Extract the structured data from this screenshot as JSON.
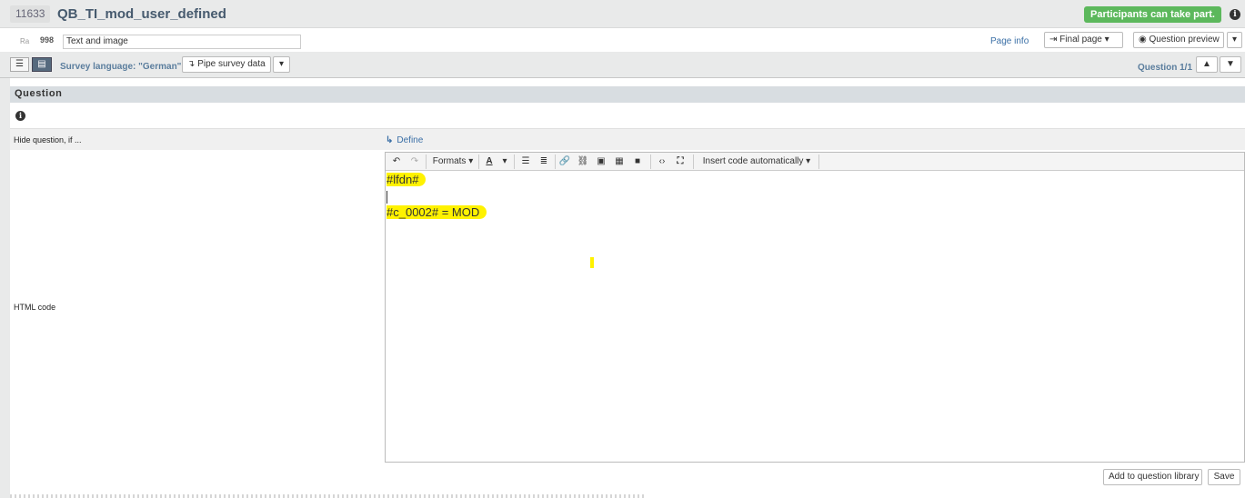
{
  "header": {
    "question_id": "11633",
    "question_name": "QB_TI_mod_user_defined",
    "status": "Participants can take part.",
    "info_icon": "info-circle-icon"
  },
  "meta": {
    "ra_label": "Ra",
    "ra_number": "998",
    "question_type": "Text and image",
    "page_info": "Page info",
    "final_page": "Final page",
    "question_preview": "Question preview"
  },
  "toolbar": {
    "survey_language": "Survey language: \"German\"",
    "pipe_survey_data": "Pipe survey data",
    "question_counter": "Question 1/1"
  },
  "section": {
    "title": "Question",
    "hide_label": "Hide question, if ...",
    "define_link": "Define",
    "html_code_label": "HTML code"
  },
  "editor": {
    "formats_label": "Formats",
    "font_color_label": "A",
    "insert_code_label": "Insert code automatically",
    "lines": [
      "#lfdn#",
      "#c_0002# = MOD"
    ],
    "highlight_color": "#fff200"
  },
  "footer": {
    "add_to_library": "Add to question library",
    "save": "Save"
  },
  "colors": {
    "status_green": "#5cb85c",
    "title_color": "#465a6e",
    "link_blue": "#3a6fa6",
    "header_bg": "#e9eaea"
  }
}
